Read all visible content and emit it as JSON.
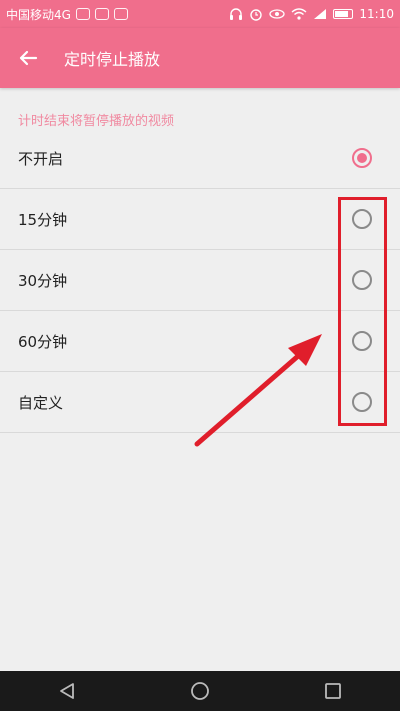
{
  "status_bar": {
    "carrier": "中国移动4G",
    "time": "11:10"
  },
  "header": {
    "title": "定时停止播放"
  },
  "section": {
    "hint": "计时结束将暂停播放的视频"
  },
  "options": [
    {
      "label": "不开启",
      "checked": true
    },
    {
      "label": "15分钟",
      "checked": false
    },
    {
      "label": "30分钟",
      "checked": false
    },
    {
      "label": "60分钟",
      "checked": false
    },
    {
      "label": "自定义",
      "checked": false
    }
  ],
  "colors": {
    "accent": "#f06e8c",
    "annotation": "#e01e2b"
  },
  "icons": {
    "back": "arrow-left-icon",
    "nav_back": "triangle-back-icon",
    "nav_home": "circle-home-icon",
    "nav_recent": "square-recent-icon"
  }
}
